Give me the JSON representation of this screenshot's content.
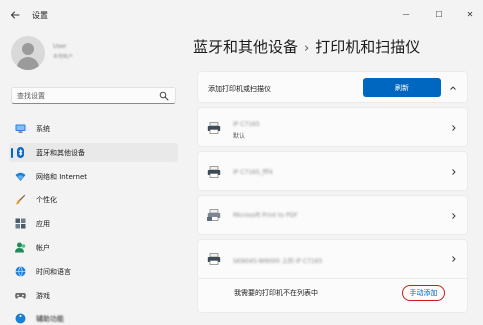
{
  "app": {
    "title": "设置",
    "minimize": "—",
    "maximize": "☐",
    "close": "✕"
  },
  "user": {
    "name": "User",
    "email": "本地帐户"
  },
  "search": {
    "placeholder": "查找设置"
  },
  "sidebar": {
    "items": [
      {
        "label": "系统",
        "icon": "monitor-icon"
      },
      {
        "label": "蓝牙和其他设备",
        "icon": "bluetooth-icon",
        "active": true
      },
      {
        "label": "网络和 Internet",
        "icon": "wifi-icon"
      },
      {
        "label": "个性化",
        "icon": "brush-icon"
      },
      {
        "label": "应用",
        "icon": "apps-icon"
      },
      {
        "label": "帐户",
        "icon": "account-icon"
      },
      {
        "label": "时间和语言",
        "icon": "globe-icon"
      },
      {
        "label": "游戏",
        "icon": "gamepad-icon"
      },
      {
        "label": "辅助功能",
        "icon": "accessibility-icon"
      }
    ]
  },
  "breadcrumb": {
    "parent": "蓝牙和其他设备",
    "separator": "›",
    "current": "打印机和扫描仪"
  },
  "add_device": {
    "label": "添加打印机或扫描仪",
    "refresh_label": "刷新"
  },
  "devices": [
    {
      "name": "iP C7165",
      "status": "默认"
    },
    {
      "name": "iP C7165_fff4",
      "status": ""
    },
    {
      "name": "Microsoft Print to PDF",
      "status": ""
    },
    {
      "name": "SKN045-W9000 上的 iP C7165",
      "status": ""
    }
  ],
  "manual": {
    "label": "我需要的打印机不在列表中",
    "link": "手动添加"
  },
  "colors": {
    "accent": "#0067c0",
    "highlight_border": "#d11a1a"
  }
}
